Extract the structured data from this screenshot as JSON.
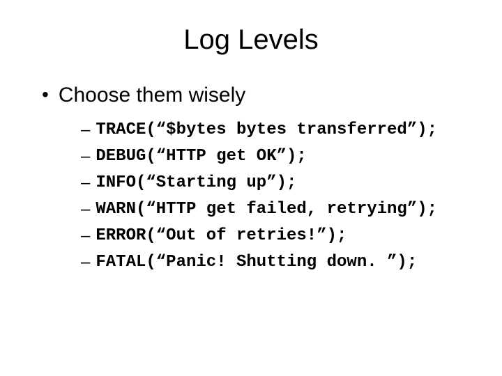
{
  "title": "Log Levels",
  "bullet": {
    "main": "Choose them wisely",
    "items": [
      "TRACE(“$bytes bytes transferred”);",
      "DEBUG(“HTTP get OK”);",
      "INFO(“Starting up”);",
      "WARN(“HTTP get failed, retrying”);",
      "ERROR(“Out of retries!”);",
      "FATAL(“Panic! Shutting down. ”);"
    ]
  }
}
